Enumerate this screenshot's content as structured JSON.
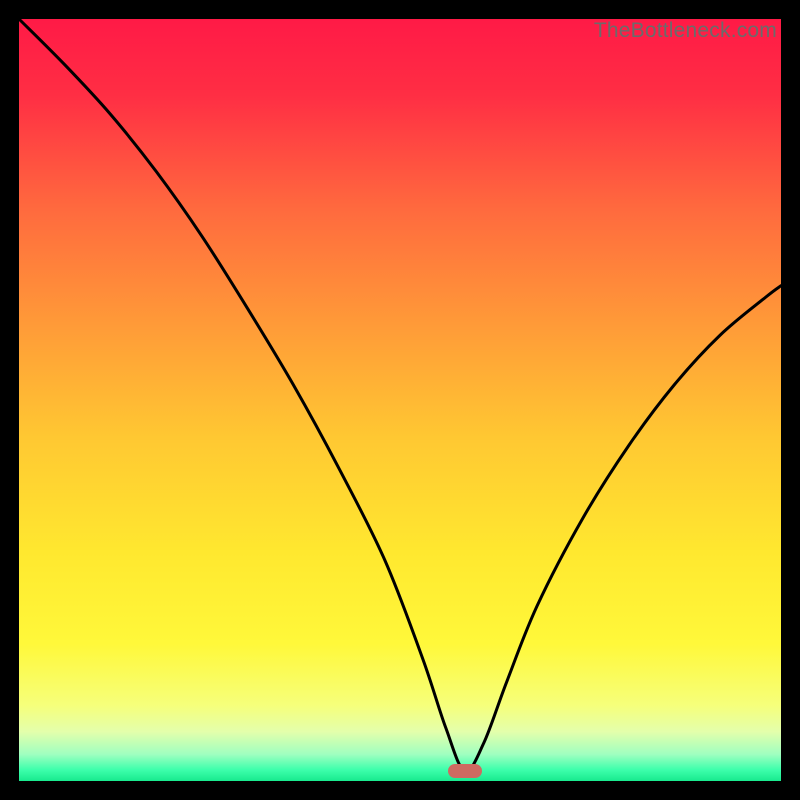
{
  "watermark": "TheBottleneck.com",
  "chart_data": {
    "type": "line",
    "title": "",
    "xlabel": "",
    "ylabel": "",
    "xlim": [
      0,
      100
    ],
    "ylim": [
      0,
      100
    ],
    "grid": false,
    "legend": false,
    "series": [
      {
        "name": "bottleneck-curve",
        "x": [
          0,
          6,
          12,
          18,
          24,
          30,
          36,
          42,
          48,
          53,
          56,
          58.5,
          61,
          64,
          68,
          74,
          80,
          86,
          92,
          98,
          100
        ],
        "y": [
          100,
          94,
          87.5,
          80,
          71.5,
          62,
          52,
          41,
          29,
          16,
          7,
          1.3,
          5,
          13,
          23,
          34.5,
          44,
          52,
          58.5,
          63.5,
          65
        ]
      }
    ],
    "minimum_marker": {
      "x": 58.5,
      "y": 1.3
    },
    "background_gradient_stops": [
      {
        "pos": 0.0,
        "color": "#ff1a46"
      },
      {
        "pos": 0.1,
        "color": "#ff2e44"
      },
      {
        "pos": 0.25,
        "color": "#ff6a3e"
      },
      {
        "pos": 0.4,
        "color": "#ff9a38"
      },
      {
        "pos": 0.55,
        "color": "#ffc832"
      },
      {
        "pos": 0.7,
        "color": "#ffe82f"
      },
      {
        "pos": 0.82,
        "color": "#fff83a"
      },
      {
        "pos": 0.9,
        "color": "#f6ff7a"
      },
      {
        "pos": 0.935,
        "color": "#e4ffab"
      },
      {
        "pos": 0.965,
        "color": "#9fffc0"
      },
      {
        "pos": 0.985,
        "color": "#3effac"
      },
      {
        "pos": 1.0,
        "color": "#18e98e"
      }
    ],
    "colors": {
      "curve": "#000000",
      "marker": "#cf6a61",
      "frame": "#000000"
    }
  }
}
